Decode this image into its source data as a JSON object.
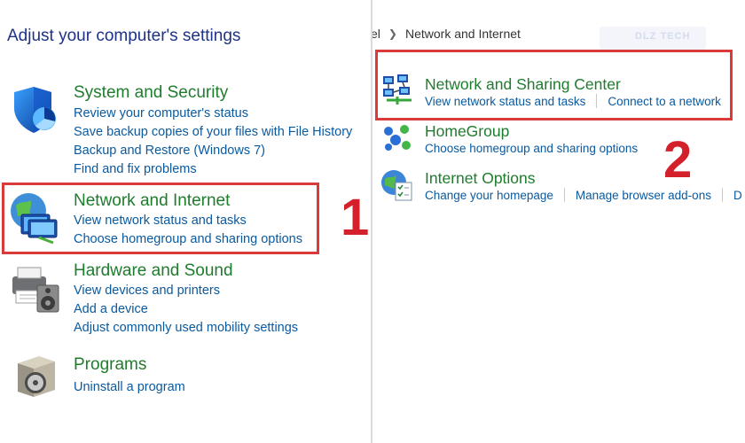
{
  "left": {
    "title": "Adjust your computer's settings",
    "categories": [
      {
        "icon": "shield-icon",
        "title": "System and Security",
        "links": [
          "Review your computer's status",
          "Save backup copies of your files with File History",
          "Backup and Restore (Windows 7)",
          "Find and fix problems"
        ]
      },
      {
        "icon": "network-globe-icon",
        "title": "Network and Internet",
        "links": [
          "View network status and tasks",
          "Choose homegroup and sharing options"
        ]
      },
      {
        "icon": "printer-speaker-icon",
        "title": "Hardware and Sound",
        "links": [
          "View devices and printers",
          "Add a device",
          "Adjust commonly used mobility settings"
        ]
      },
      {
        "icon": "programs-disc-icon",
        "title": "Programs",
        "links": [
          "Uninstall a program"
        ]
      }
    ]
  },
  "annotations": {
    "step1": "1",
    "step2": "2"
  },
  "right": {
    "breadcrumb": {
      "fragment": "el",
      "current": "Network and Internet"
    },
    "watermark": "DLZ TECH",
    "categories": [
      {
        "icon": "network-sharing-icon",
        "title": "Network and Sharing Center",
        "links": [
          "View network status and tasks",
          "Connect to a network"
        ]
      },
      {
        "icon": "homegroup-icon",
        "title": "HomeGroup",
        "links": [
          "Choose homegroup and sharing options"
        ]
      },
      {
        "icon": "internet-options-icon",
        "title": "Internet Options",
        "links": [
          "Change your homepage",
          "Manage browser add-ons",
          "D"
        ]
      }
    ]
  },
  "colors": {
    "category_title": "#1e7d2c",
    "link": "#0a5aa0",
    "page_title": "#1e3287",
    "highlight": "#d93a3a",
    "step_number": "#d3202a"
  }
}
